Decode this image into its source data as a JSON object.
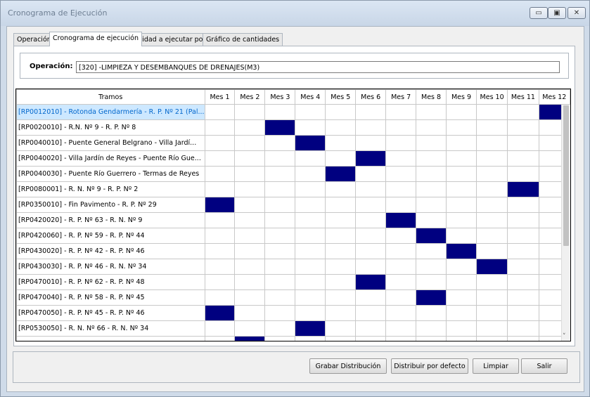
{
  "window": {
    "title": "Cronograma de Ejecución"
  },
  "window_buttons": {
    "minimize": "▭",
    "maximize": "▣",
    "close": "✕"
  },
  "tabs": [
    {
      "label": "Operación",
      "active": false
    },
    {
      "label": "Cronograma de ejecución",
      "active": true
    },
    {
      "label": "Cantidad a ejecutar por mes",
      "active": false
    },
    {
      "label": "Gráfico de cantidades",
      "active": false
    }
  ],
  "operation": {
    "label": "Operación:",
    "value": "[320] -LIMPIEZA Y DESEMBANQUES DE DRENAJES(M3)"
  },
  "grid": {
    "header_tramos": "Tramos",
    "months": [
      "Mes 1",
      "Mes 2",
      "Mes 3",
      "Mes 4",
      "Mes 5",
      "Mes 6",
      "Mes 7",
      "Mes 8",
      "Mes 9",
      "Mes 10",
      "Mes 11",
      "Mes 12"
    ],
    "selected_row": 0,
    "fill_color": "#000080",
    "rows": [
      {
        "tramo": "[RP0012010] - Rotonda Gendarmería - R. P. Nº 21 (Pal...",
        "month": 12
      },
      {
        "tramo": "[RP0020010] - R.N. Nº 9 - R. P. Nº 8",
        "month": 3
      },
      {
        "tramo": "[RP0040010] - Puente General Belgrano - Villa Jardí...",
        "month": 4
      },
      {
        "tramo": "[RP0040020] - Villa Jardín de Reyes - Puente Río Gue...",
        "month": 6
      },
      {
        "tramo": "[RP0040030] - Puente Río Guerrero - Termas de Reyes",
        "month": 5
      },
      {
        "tramo": "[RP0080001] - R. N. Nº 9 - R. P. Nº 2",
        "month": 11
      },
      {
        "tramo": "[RP0350010] - Fin Pavimento - R. P. Nº 29",
        "month": 1
      },
      {
        "tramo": "[RP0420020] - R. P. Nº 63 - R. N. Nº 9",
        "month": 7
      },
      {
        "tramo": "[RP0420060] - R. P. Nº 59 - R. P. Nº 44",
        "month": 8
      },
      {
        "tramo": "[RP0430020] - R. P. Nº 42 - R. P. Nº 46",
        "month": 9
      },
      {
        "tramo": "[RP0430030] - R. P. Nº 46 - R. N. Nº 34",
        "month": 10
      },
      {
        "tramo": "[RP0470010] - R. P. Nº 62 - R. P. Nº 48",
        "month": 6
      },
      {
        "tramo": "[RP0470040] - R. P. Nº 58 - R. P. Nº 45",
        "month": 8
      },
      {
        "tramo": "[RP0470050] - R. P. Nº 45 - R. P. Nº 46",
        "month": 1
      },
      {
        "tramo": "[RP0530050] - R. N. Nº 66 - R. N. Nº 34",
        "month": 4
      },
      {
        "tramo": "",
        "month": 2
      }
    ]
  },
  "scrollbar": {
    "down_arrow": "˅"
  },
  "buttons": {
    "grabar": "Grabar Distribución",
    "distribuir": "Distribuir por defecto",
    "limpiar": "Limpiar",
    "salir": "Salir"
  }
}
